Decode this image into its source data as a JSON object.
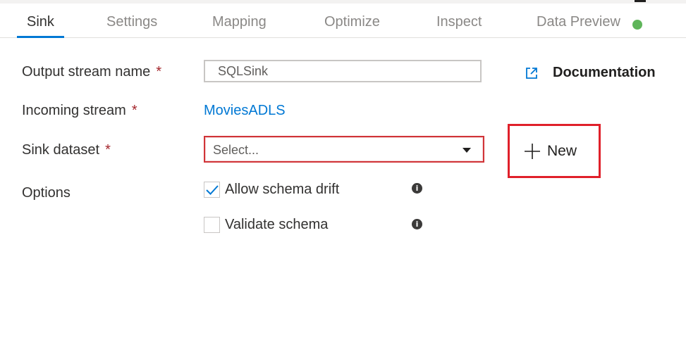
{
  "tabs": [
    {
      "label": "Sink",
      "active": true
    },
    {
      "label": "Settings",
      "active": false
    },
    {
      "label": "Mapping",
      "active": false
    },
    {
      "label": "Optimize",
      "active": false
    },
    {
      "label": "Inspect",
      "active": false
    },
    {
      "label": "Data Preview",
      "active": false,
      "status_color": "#5fb55a"
    }
  ],
  "form": {
    "output_stream": {
      "label": "Output stream name",
      "required_mark": "*",
      "value": "SQLSink"
    },
    "incoming_stream": {
      "label": "Incoming stream",
      "required_mark": "*",
      "value": "MoviesADLS"
    },
    "sink_dataset": {
      "label": "Sink dataset",
      "required_mark": "*",
      "placeholder": "Select..."
    },
    "options": {
      "label": "Options",
      "allow_schema_drift": {
        "label": "Allow schema drift",
        "checked": true,
        "info_icon": "info-icon"
      },
      "validate_schema": {
        "label": "Validate schema",
        "checked": false,
        "info_icon": "info-icon"
      }
    }
  },
  "documentation": {
    "label": "Documentation",
    "icon": "external-link-icon"
  },
  "new_button": {
    "label": "New",
    "icon": "plus-icon",
    "highlight_color": "#e0202a"
  },
  "colors": {
    "accent": "#0078d4",
    "error": "#d13438",
    "success": "#5fb55a"
  }
}
